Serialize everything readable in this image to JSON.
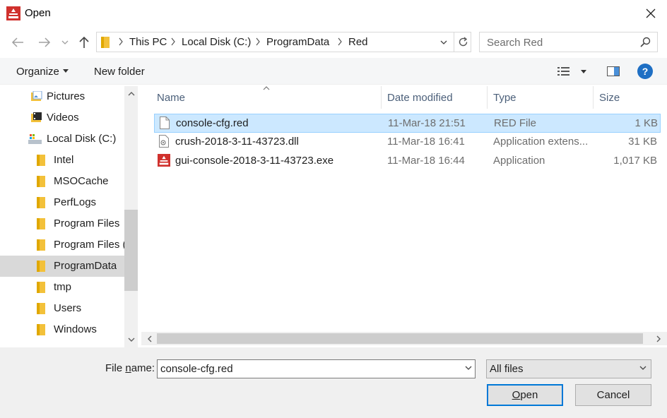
{
  "window": {
    "title": "Open"
  },
  "navigation": {
    "breadcrumb": [
      "This PC",
      "Local Disk (C:)",
      "ProgramData",
      "Red"
    ],
    "search_placeholder": "Search Red"
  },
  "toolbar": {
    "organize_label": "Organize",
    "new_folder_label": "New folder",
    "help_label": "?"
  },
  "nav_pane": {
    "items": [
      {
        "label": "Pictures",
        "icon": "pictures-icon"
      },
      {
        "label": "Videos",
        "icon": "videos-icon"
      },
      {
        "label": "Local Disk (C:)",
        "icon": "drive-icon"
      },
      {
        "label": "Intel",
        "icon": "folder-icon"
      },
      {
        "label": "MSOCache",
        "icon": "folder-icon"
      },
      {
        "label": "PerfLogs",
        "icon": "folder-icon"
      },
      {
        "label": "Program Files",
        "icon": "folder-icon"
      },
      {
        "label": "Program Files (",
        "icon": "folder-icon"
      },
      {
        "label": "ProgramData",
        "icon": "folder-icon",
        "selected": true
      },
      {
        "label": "tmp",
        "icon": "folder-icon"
      },
      {
        "label": "Users",
        "icon": "folder-icon"
      },
      {
        "label": "Windows",
        "icon": "folder-icon"
      }
    ]
  },
  "file_list": {
    "columns": [
      "Name",
      "Date modified",
      "Type",
      "Size"
    ],
    "rows": [
      {
        "name": "console-cfg.red",
        "date": "11-Mar-18 21:51",
        "type": "RED File",
        "size": "1 KB",
        "icon": "document-icon",
        "selected": true
      },
      {
        "name": "crush-2018-3-11-43723.dll",
        "date": "11-Mar-18 16:41",
        "type": "Application extens...",
        "size": "31 KB",
        "icon": "dll-icon"
      },
      {
        "name": "gui-console-2018-3-11-43723.exe",
        "date": "11-Mar-18 16:44",
        "type": "Application",
        "size": "1,017 KB",
        "icon": "red-app-icon"
      }
    ]
  },
  "bottom": {
    "file_name_label_pre": "File ",
    "file_name_label_ul": "n",
    "file_name_label_post": "ame:",
    "file_name_value": "console-cfg.red",
    "filter_value": "All files",
    "open_ul": "O",
    "open_rest": "pen",
    "cancel_label": "Cancel"
  },
  "colors": {
    "accent": "#0078d7",
    "selection": "#cce8ff",
    "app_red": "#d0312d",
    "folder": "#f3c13a"
  }
}
